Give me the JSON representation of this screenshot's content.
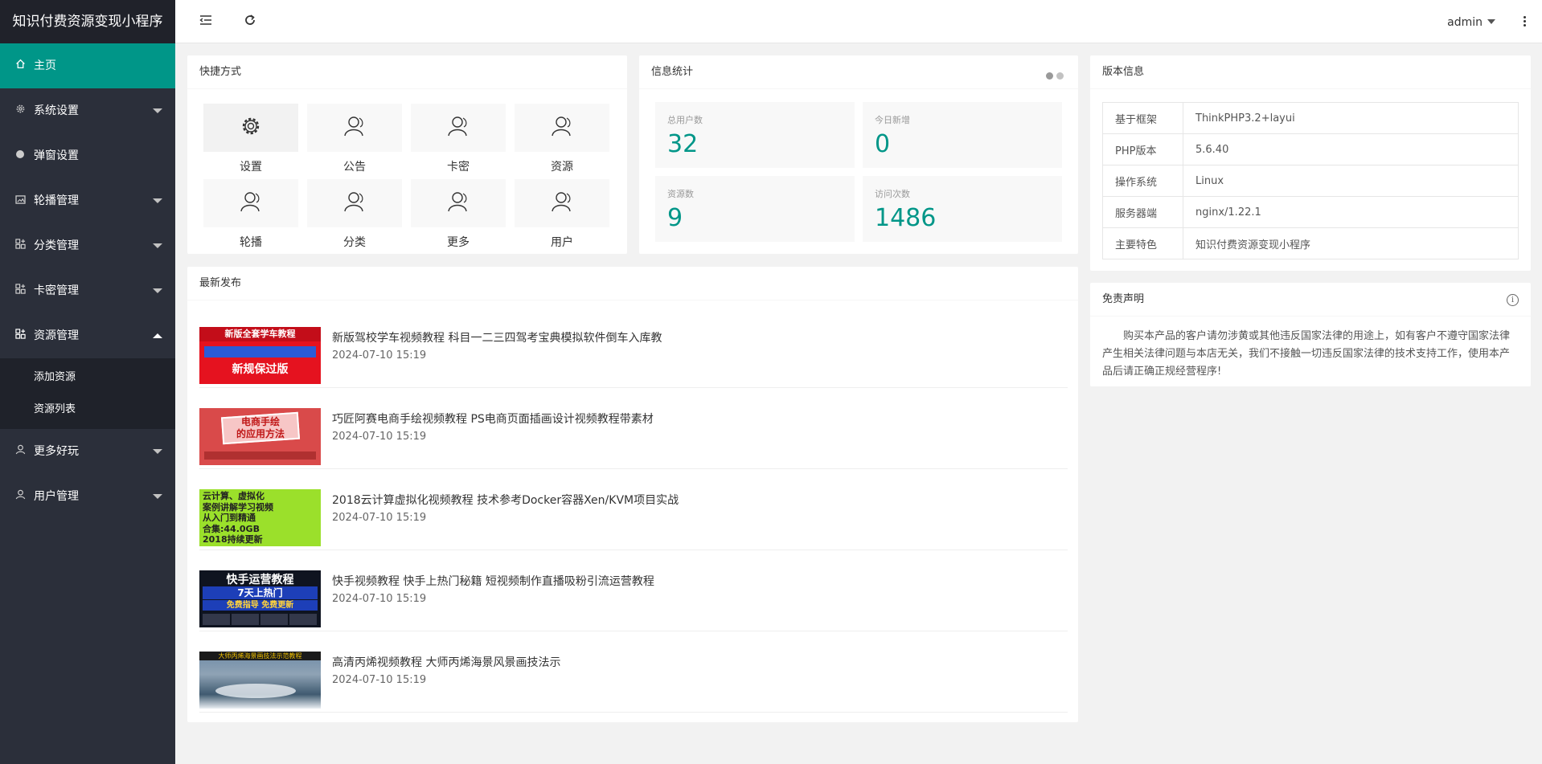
{
  "app": {
    "title": "知识付费资源变现小程序"
  },
  "header": {
    "user": "admin"
  },
  "sidebar": {
    "items": [
      {
        "label": "主页",
        "icon": "home-icon"
      },
      {
        "label": "系统设置",
        "icon": "gear-icon"
      },
      {
        "label": "弹窗设置",
        "icon": "dot-icon"
      },
      {
        "label": "轮播管理",
        "icon": "image-icon"
      },
      {
        "label": "分类管理",
        "icon": "apps-icon"
      },
      {
        "label": "卡密管理",
        "icon": "apps-icon"
      },
      {
        "label": "资源管理",
        "icon": "apps-icon"
      },
      {
        "label": "更多好玩",
        "icon": "user-icon"
      },
      {
        "label": "用户管理",
        "icon": "user-icon"
      }
    ],
    "sub_items": [
      "添加资源",
      "资源列表"
    ]
  },
  "quick": {
    "title": "快捷方式",
    "items": [
      {
        "label": "设置",
        "icon": "gear-icon"
      },
      {
        "label": "公告",
        "icon": "user-icon"
      },
      {
        "label": "卡密",
        "icon": "user-icon"
      },
      {
        "label": "资源",
        "icon": "user-icon"
      },
      {
        "label": "轮播",
        "icon": "user-icon"
      },
      {
        "label": "分类",
        "icon": "user-icon"
      },
      {
        "label": "更多",
        "icon": "user-icon"
      },
      {
        "label": "用户",
        "icon": "user-icon"
      }
    ]
  },
  "stats": {
    "title": "信息统计",
    "items": [
      {
        "label": "总用户数",
        "value": "32"
      },
      {
        "label": "今日新增",
        "value": "0"
      },
      {
        "label": "资源数",
        "value": "9"
      },
      {
        "label": "访问次数",
        "value": "1486"
      }
    ]
  },
  "version": {
    "title": "版本信息",
    "rows": [
      {
        "key": "基于框架",
        "value": "ThinkPHP3.2+layui"
      },
      {
        "key": "PHP版本",
        "value": "5.6.40"
      },
      {
        "key": "操作系统",
        "value": "Linux"
      },
      {
        "key": "服务器端",
        "value": "nginx/1.22.1"
      },
      {
        "key": "主要特色",
        "value": "知识付费资源变现小程序"
      }
    ]
  },
  "disclaimer": {
    "title": "免责声明",
    "text": "购买本产品的客户请勿涉黄或其他违反国家法律的用途上，如有客户不遵守国家法律 产生相关法律问题与本店无关，我们不接触一切违反国家法律的技术支持工作，使用本产品后请正确正规经营程序!"
  },
  "latest": {
    "title": "最新发布",
    "items": [
      {
        "title": "新版驾校学车视频教程 科目一二三四驾考宝典模拟软件倒车入库教",
        "date": "2024-07-10 15:19",
        "thumb_text": [
          "新版全套学车教程",
          "新规保过版"
        ]
      },
      {
        "title": "巧匠阿赛电商手绘视频教程 PS电商页面插画设计视频教程带素材",
        "date": "2024-07-10 15:19",
        "thumb_text": [
          "电商手绘",
          "的应用方法"
        ]
      },
      {
        "title": "2018云计算虚拟化视频教程 技术参考Docker容器Xen/KVM项目实战",
        "date": "2024-07-10 15:19",
        "thumb_text": [
          "云计算、虚拟化",
          "案例讲解学习视频",
          "从入门到精通",
          "合集:44.0GB",
          "2018持续更新"
        ]
      },
      {
        "title": "快手视频教程 快手上热门秘籍 短视频制作直播吸粉引流运营教程",
        "date": "2024-07-10 15:19",
        "thumb_text": [
          "快手运营教程",
          "7天上热门",
          "免费指导 免费更新"
        ]
      },
      {
        "title": "高清丙烯视频教程 大师丙烯海景风景画技法示",
        "date": "2024-07-10 15:19",
        "thumb_text": [
          "大师丙烯海景画技法示范教程"
        ]
      }
    ]
  },
  "colors": {
    "accent": "#009688",
    "sidebar": "#2b2f3a",
    "logo_bg": "#20222a"
  }
}
